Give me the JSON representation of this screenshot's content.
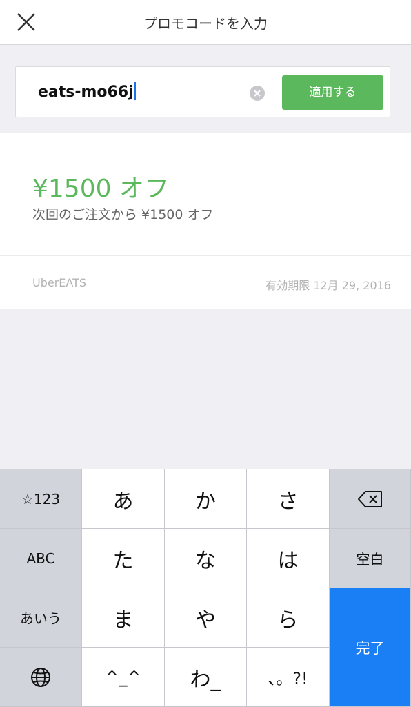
{
  "header": {
    "title": "プロモコードを入力"
  },
  "input": {
    "value": "eats-mo66j"
  },
  "apply_button": {
    "label": "適用する"
  },
  "promo": {
    "amount": "¥1500 オフ",
    "description": "次回のご注文から ¥1500 オフ",
    "brand": "UberEATS",
    "expiry": "有効期限 12月 29, 2016"
  },
  "keyboard": {
    "numbers_key": "☆123",
    "abc_key": "ABC",
    "aiu_key": "あいう",
    "space_key": "空白",
    "done_key": "完了",
    "keys": [
      [
        "あ",
        "か",
        "さ"
      ],
      [
        "た",
        "な",
        "は"
      ],
      [
        "ま",
        "や",
        "ら"
      ],
      [
        "^_^",
        "わ_",
        "、。?!"
      ]
    ]
  },
  "colors": {
    "accent_green": "#5cb85c",
    "done_blue": "#1a7ff5"
  }
}
